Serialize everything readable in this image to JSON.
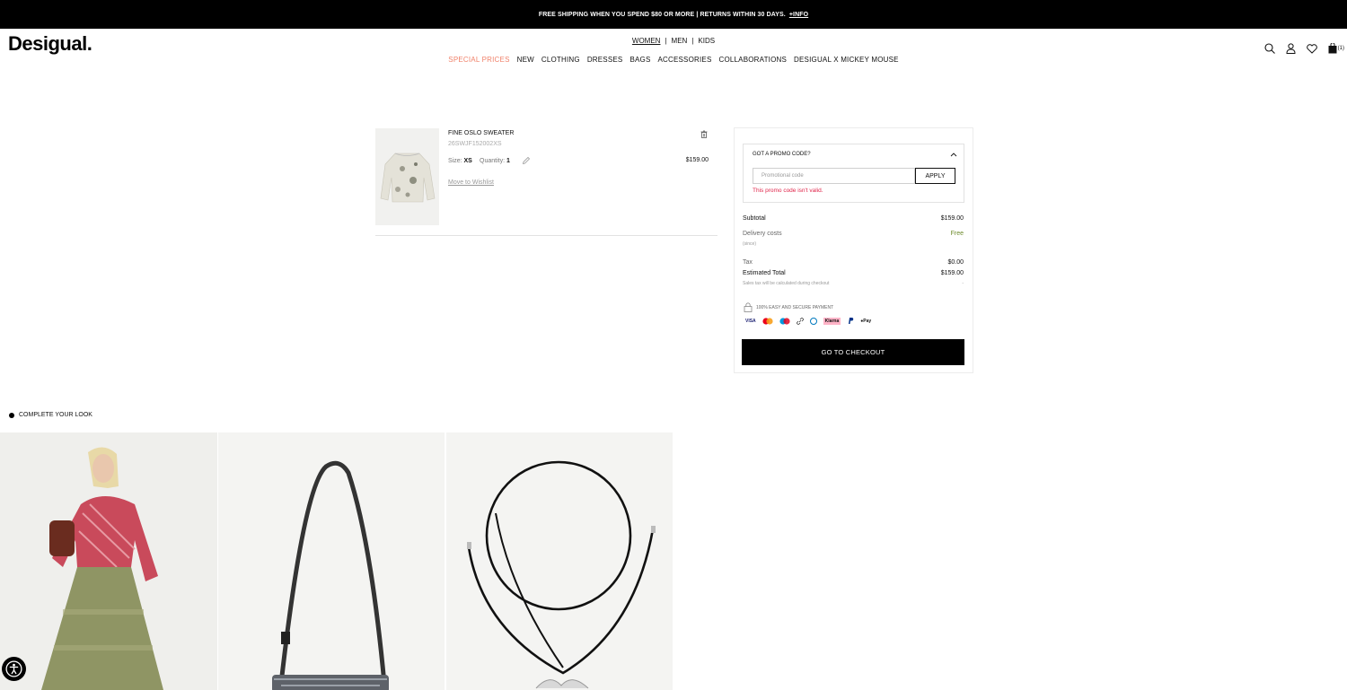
{
  "announcement": {
    "text": "FREE SHIPPING WHEN YOU SPEND $80 OR MORE | RETURNS WITHIN 30 DAYS.",
    "link": "+INFO"
  },
  "brand": {
    "logo": "Desigual."
  },
  "gender_nav": {
    "women": "WOMEN",
    "men": "MEN",
    "kids": "KIDS",
    "separator": "|"
  },
  "main_nav": [
    "SPECIAL PRICES",
    "NEW",
    "CLOTHING",
    "DRESSES",
    "BAGS",
    "ACCESSORIES",
    "COLLABORATIONS",
    "DESIGUAL X MICKEY MOUSE"
  ],
  "header_icons": {
    "cart_count": "(1)"
  },
  "cart_item": {
    "name": "FINE OSLO SWEATER",
    "sku": "26SWJF152002XS",
    "size_label": "Size:",
    "size_value": "XS",
    "quantity_label": "Quantity:",
    "quantity_value": "1",
    "wishlist": "Move to Wishlist",
    "price": "$159.00"
  },
  "promo": {
    "title": "GOT A PROMO CODE?",
    "placeholder": "Promotional code",
    "apply": "APPLY",
    "error": "This promo code isn't valid."
  },
  "summary": {
    "subtotal_label": "Subtotal",
    "subtotal_value": "$159.00",
    "delivery_label": "Delivery costs",
    "delivery_value": "Free",
    "delivery_note": "(since)",
    "tax_label": "Tax",
    "tax_value": "$0.00",
    "total_label": "Estimated Total",
    "total_value": "$159.00",
    "tax_note": "Sales tax will be calculated during checkout",
    "tax_note_value": "-",
    "secure": "100% EASY AND SECURE PAYMENT",
    "checkout": "GO TO CHECKOUT"
  },
  "payments": {
    "visa": "VISA",
    "klarna": "Klarna",
    "applepay": "Pay"
  },
  "complete_look": {
    "title": "COMPLETE YOUR LOOK"
  },
  "colors": {
    "special": "#f0826b",
    "error": "#e0254a",
    "free": "#6c8a2a"
  }
}
